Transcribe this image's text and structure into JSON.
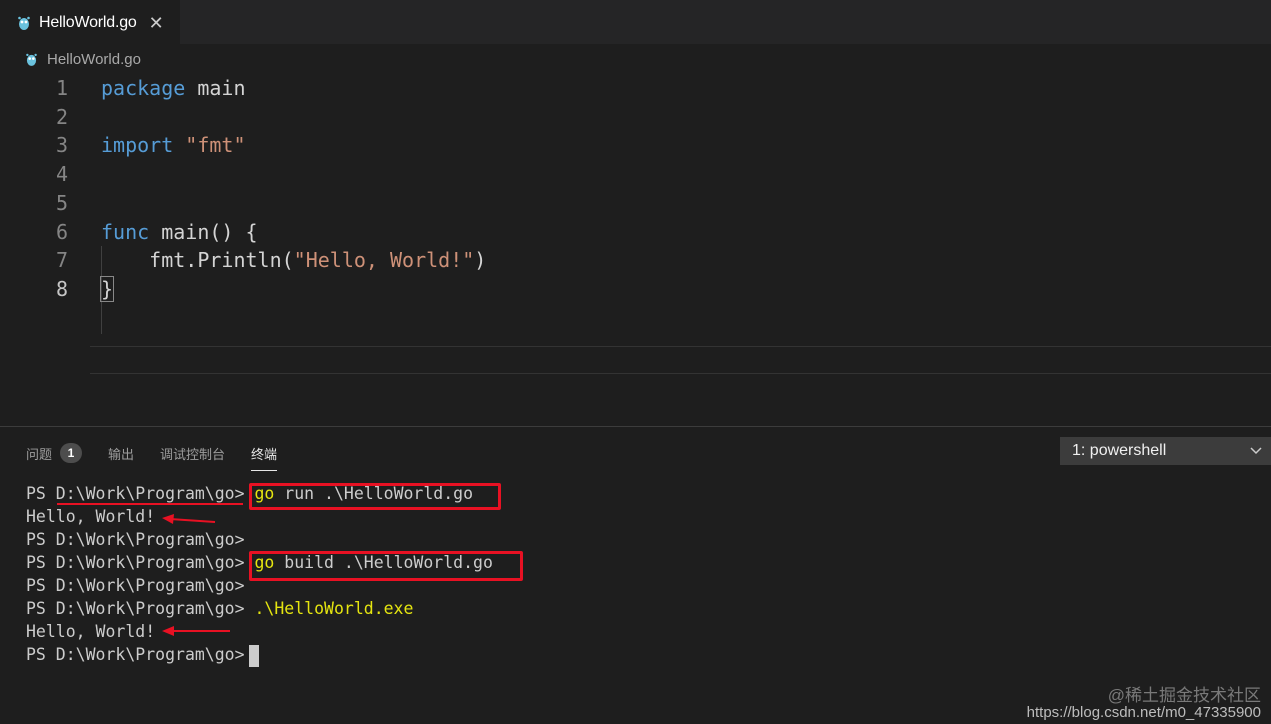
{
  "tab": {
    "label": "HelloWorld.go",
    "close_glyph": "✕"
  },
  "breadcrumb": {
    "label": "HelloWorld.go"
  },
  "editor": {
    "line_numbers": [
      "1",
      "2",
      "3",
      "4",
      "5",
      "6",
      "7",
      "8"
    ],
    "lines": {
      "l1_kw": "package",
      "l1_rest": " main",
      "l3_kw": "import",
      "l3_str": " \"fmt\"",
      "l6_kw": "func",
      "l6_fn": " main",
      "l6_rest": "() {",
      "l7_pre": "    fmt.",
      "l7_fn": "Println",
      "l7_open": "(",
      "l7_str": "\"Hello, World!\"",
      "l7_close": ")",
      "l8": "}"
    }
  },
  "panel": {
    "tabs": [
      "问题",
      "输出",
      "调试控制台",
      "终端"
    ],
    "problems_badge": "1",
    "terminal_select": "1: powershell"
  },
  "terminal": {
    "prompt": "PS D:\\Work\\Program\\go>",
    "line1_cmd": "go",
    "line1_arg": " run .\\HelloWorld.go",
    "line2": "Hello, World!",
    "line4_cmd": "go",
    "line4_arg": " build .\\HelloWorld.go",
    "line6_cmd": ".\\HelloWorld.exe",
    "line7": "Hello, World!"
  },
  "watermark": {
    "line1": "@稀土掘金技术社区",
    "line2": "https://blog.csdn.net/m0_47335900"
  },
  "colors": {
    "keyword": "#569cd6",
    "string": "#ce9178",
    "function": "#dcdcaa",
    "annotation_red": "#e81123",
    "command_yellow": "#e5e510"
  }
}
